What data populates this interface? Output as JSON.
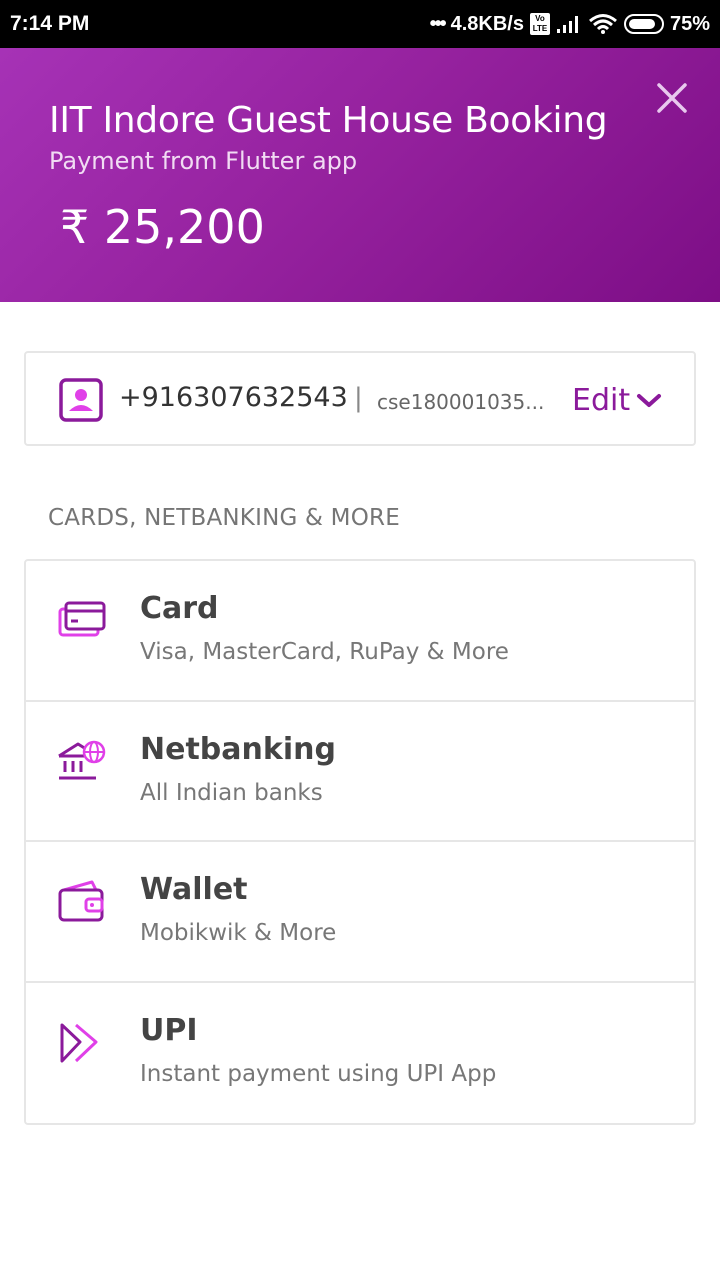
{
  "status_bar": {
    "time": "7:14 PM",
    "network_speed": "4.8KB/s",
    "volte": "Vo LTE",
    "battery": "75%",
    "icons": [
      "signal-icon",
      "wifi-icon",
      "battery-icon"
    ]
  },
  "header": {
    "title": "IIT Indore Guest House Booking",
    "subtitle": "Payment from Flutter app",
    "amount": "₹ 25,200",
    "close_icon": "close-icon",
    "gradient_start": "#a632b6",
    "gradient_end": "#7d0e86"
  },
  "contact": {
    "phone": "+916307632543",
    "separator": "|",
    "email": "cse180001035...",
    "edit_label": "Edit",
    "accent": "#8b1a9b"
  },
  "section": {
    "label": "CARDS, NETBANKING & MORE"
  },
  "methods": [
    {
      "title": "Card",
      "description": "Visa, MasterCard, RuPay & More",
      "icon": "card-icon"
    },
    {
      "title": "Netbanking",
      "description": "All Indian banks",
      "icon": "bank-icon"
    },
    {
      "title": "Wallet",
      "description": "Mobikwik & More",
      "icon": "wallet-icon"
    },
    {
      "title": "UPI",
      "description": "Instant payment using UPI App",
      "icon": "upi-icon"
    }
  ]
}
